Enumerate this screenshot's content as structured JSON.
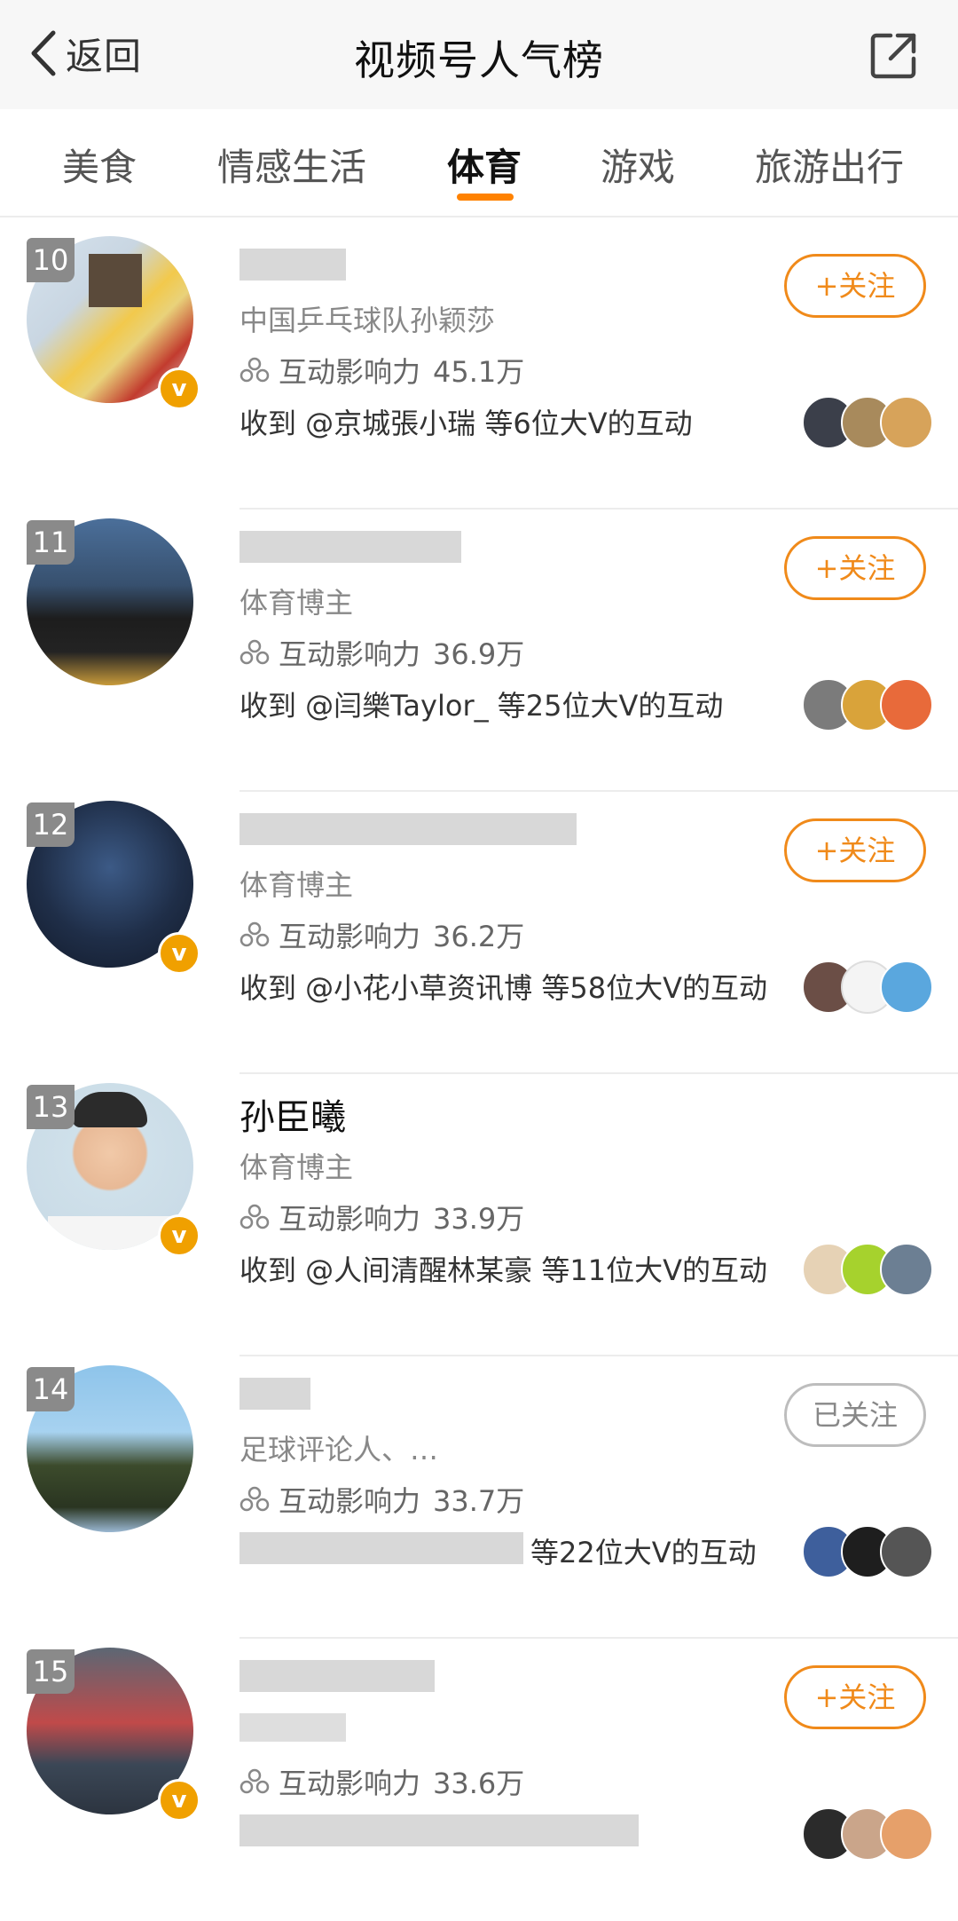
{
  "header": {
    "back_label": "返回",
    "title": "视频号人气榜"
  },
  "tabs": [
    {
      "label": "美食",
      "active": false
    },
    {
      "label": "情感生活",
      "active": false
    },
    {
      "label": "体育",
      "active": true
    },
    {
      "label": "游戏",
      "active": false
    },
    {
      "label": "旅游出行",
      "active": false
    }
  ],
  "colors": {
    "accent": "#ff8200",
    "follow_border": "#f08a1a",
    "verified_badge": "#f0a000"
  },
  "influence_label": "互动影响力",
  "entries": [
    {
      "rank": "10",
      "name": "",
      "desc": "中国乒乓球队孙颖莎",
      "influence": "45.1万",
      "received": "收到 @京城張小瑞 等6位大V的互动",
      "follow_label": "+关注",
      "followed": false,
      "verified": true
    },
    {
      "rank": "11",
      "name": "",
      "desc": "体育博主",
      "influence": "36.9万",
      "received": "收到 @闫樂Taylor_ 等25位大V的互动",
      "follow_label": "+关注",
      "followed": false,
      "verified": false
    },
    {
      "rank": "12",
      "name": "",
      "desc": "体育博主",
      "influence": "36.2万",
      "received": "收到 @小花小草资讯博 等58位大V的互动",
      "follow_label": "+关注",
      "followed": false,
      "verified": true
    },
    {
      "rank": "13",
      "name": "孙臣曦",
      "desc": "体育博主",
      "influence": "33.9万",
      "received": "收到 @人间清醒林某豪 等11位大V的互动",
      "follow_label": "",
      "followed": false,
      "verified": true
    },
    {
      "rank": "14",
      "name": "",
      "desc": "足球评论人、…",
      "influence": "33.7万",
      "received": "等22位大V的互动",
      "follow_label": "已关注",
      "followed": true,
      "verified": false
    },
    {
      "rank": "15",
      "name": "",
      "desc": "",
      "influence": "33.6万",
      "received": "",
      "follow_label": "+关注",
      "followed": false,
      "verified": true
    }
  ]
}
